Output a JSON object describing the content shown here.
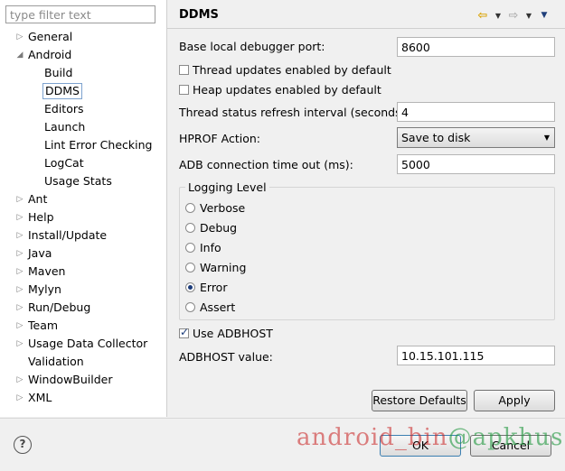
{
  "filter": {
    "placeholder": "type filter text"
  },
  "tree": {
    "items": [
      {
        "label": "General",
        "expanded": false
      },
      {
        "label": "Android",
        "expanded": true
      },
      {
        "label": "Build",
        "child": true
      },
      {
        "label": "DDMS",
        "child": true,
        "selected": true
      },
      {
        "label": "Editors",
        "child": true
      },
      {
        "label": "Launch",
        "child": true
      },
      {
        "label": "Lint Error Checking",
        "child": true
      },
      {
        "label": "LogCat",
        "child": true
      },
      {
        "label": "Usage Stats",
        "child": true
      },
      {
        "label": "Ant",
        "expanded": false
      },
      {
        "label": "Help",
        "expanded": false
      },
      {
        "label": "Install/Update",
        "expanded": false
      },
      {
        "label": "Java",
        "expanded": false
      },
      {
        "label": "Maven",
        "expanded": false
      },
      {
        "label": "Mylyn",
        "expanded": false
      },
      {
        "label": "Run/Debug",
        "expanded": false
      },
      {
        "label": "Team",
        "expanded": false
      },
      {
        "label": "Usage Data Collector",
        "expanded": false
      },
      {
        "label": "Validation",
        "leaf": true
      },
      {
        "label": "WindowBuilder",
        "expanded": false
      },
      {
        "label": "XML",
        "expanded": false
      }
    ]
  },
  "page": {
    "title": "DDMS",
    "debugger_port": {
      "label": "Base local debugger port:",
      "value": "8600"
    },
    "thread_updates": {
      "label": "Thread updates enabled by default",
      "checked": false
    },
    "heap_updates": {
      "label": "Heap updates enabled by default",
      "checked": false
    },
    "refresh_interval": {
      "label": "Thread status refresh interval (seconds):",
      "value": "4"
    },
    "hprof": {
      "label": "HPROF Action:",
      "value": "Save to disk"
    },
    "adb_timeout": {
      "label": "ADB connection time out (ms):",
      "value": "5000"
    },
    "logging": {
      "title": "Logging Level",
      "options": [
        "Verbose",
        "Debug",
        "Info",
        "Warning",
        "Error",
        "Assert"
      ],
      "selected": "Error"
    },
    "use_adbhost": {
      "label": "Use ADBHOST",
      "checked": true
    },
    "adbhost_value": {
      "label": "ADBHOST value:",
      "value": "10.15.101.115"
    },
    "restore_defaults": "Restore Defaults",
    "apply": "Apply"
  },
  "footer": {
    "ok": "OK",
    "cancel": "Cancel",
    "help_icon": "?"
  },
  "watermark": {
    "text_a": "android_bin",
    "text_b": "@apkhus"
  }
}
